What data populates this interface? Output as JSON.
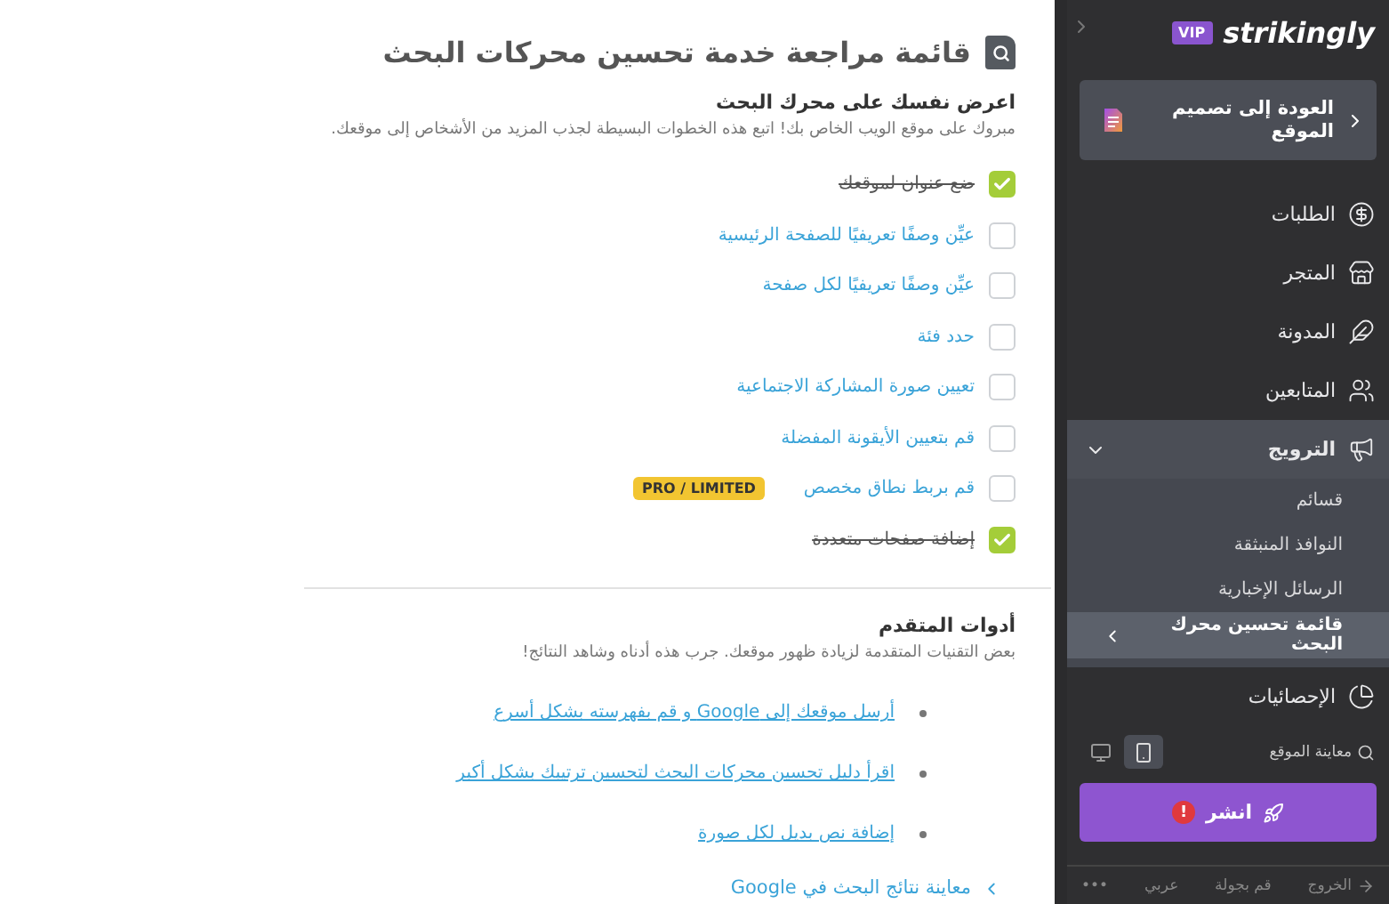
{
  "header": {
    "title": "قائمة مراجعة خدمة تحسين محركات البحث"
  },
  "intro": {
    "heading": "اعرض نفسك على محرك البحث",
    "description": "مبروك على موقع الويب الخاص بك! اتبع هذه الخطوات البسيطة لجذب المزيد من الأشخاص إلى موقعك."
  },
  "checklist": [
    {
      "label": "ضع عنوان لموقعك",
      "checked": true
    },
    {
      "label": "عيِّن وصفًا تعريفيًا للصفحة الرئيسية",
      "checked": false
    },
    {
      "label": "عيِّن وصفًا تعريفيًا لكل صفحة",
      "checked": false
    },
    {
      "label": "حدد فئة",
      "checked": false
    },
    {
      "label": "تعيين صورة المشاركة الاجتماعية",
      "checked": false
    },
    {
      "label": "قم بتعيين الأيقونة المفضلة",
      "checked": false
    },
    {
      "label": "قم بربط نطاق مخصص",
      "checked": false,
      "badge": "PRO / LIMITED"
    },
    {
      "label": "إضافة صفحات متعددة",
      "checked": true
    }
  ],
  "advanced": {
    "heading": "أدوات المتقدم",
    "description": "بعض التقنيات المتقدمة لزيادة ظهور موقعك. جرب هذه أدناه وشاهد النتائج!",
    "links": [
      "أرسل موقعك إلى Google و قم بفهرسته بشكل أسرع",
      "اقرأ دليل تحسين محركات البحث لتحسين ترتيبك بشكل أكبر",
      "إضافة نص بديل لكل صورة"
    ]
  },
  "google_preview": {
    "label": "معاينة نتائج البحث في Google"
  },
  "sidebar": {
    "logo": {
      "badge": "VIP",
      "brand": "strikingly"
    },
    "back_button": "العودة إلى تصميم الموقع",
    "nav": [
      {
        "label": "الطلبات"
      },
      {
        "label": "المتجر"
      },
      {
        "label": "المدونة"
      },
      {
        "label": "المتابعين"
      },
      {
        "label": "الترويج",
        "expanded": true,
        "children": [
          {
            "label": "قسائم",
            "selected": false
          },
          {
            "label": "النوافذ المنبثقة",
            "selected": false
          },
          {
            "label": "الرسائل الإخبارية",
            "selected": false
          },
          {
            "label": "قائمة تحسين محرك البحث",
            "selected": true
          }
        ]
      },
      {
        "label": "الإحصائيات"
      }
    ],
    "preview_label": "معاينة الموقع",
    "devices": [
      {
        "kind": "desktop",
        "selected": false
      },
      {
        "kind": "mobile",
        "selected": true
      }
    ],
    "publish": {
      "label": "انشر",
      "alert": "!"
    },
    "footer": [
      "الخروج",
      "قم بجولة",
      "عربي",
      "•••"
    ]
  }
}
